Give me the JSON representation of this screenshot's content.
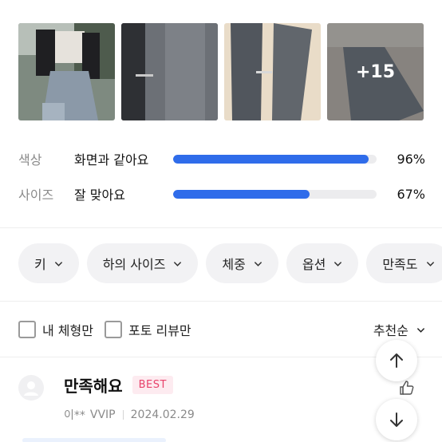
{
  "photos": {
    "more_count": "+15"
  },
  "stats": [
    {
      "label": "색상",
      "value": "화면과 같아요",
      "percent_text": "96%",
      "fraction": 0.96,
      "color": "#2f6cea"
    },
    {
      "label": "사이즈",
      "value": "잘 맞아요",
      "percent_text": "67%",
      "fraction": 0.67,
      "color": "#2f6cea"
    }
  ],
  "filters": [
    {
      "label": "키",
      "icon": "chevron-down-icon"
    },
    {
      "label": "하의 사이즈",
      "icon": "chevron-down-icon"
    },
    {
      "label": "체중",
      "icon": "chevron-down-icon"
    },
    {
      "label": "옵션",
      "icon": "chevron-down-icon"
    },
    {
      "label": "만족도",
      "icon": "chevron-down-icon"
    }
  ],
  "options": {
    "my_body_label": "내 체형만",
    "photo_review_label": "포토 리뷰만",
    "sort_label": "추천순"
  },
  "review": {
    "title": "만족해요",
    "badge": "BEST",
    "user": "이**",
    "grade": "VVIP",
    "date": "2024.02.29"
  },
  "colors": {
    "accent": "#2f6cea",
    "badge_text": "#e8426b",
    "badge_bg": "#fdebf0"
  }
}
